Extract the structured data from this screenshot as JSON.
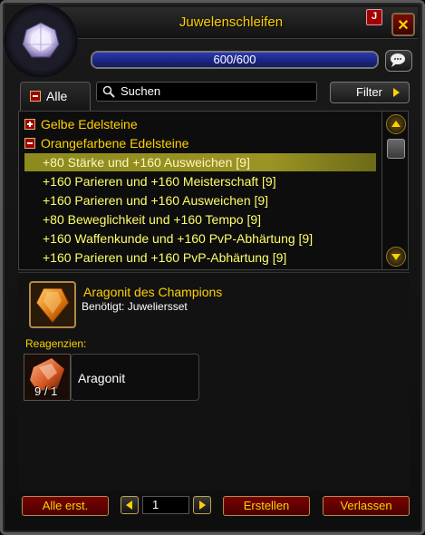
{
  "window": {
    "title": "Juwelenschleifen",
    "badge": "J"
  },
  "close_label": "✕",
  "progress": {
    "text": "600/600",
    "fraction": 1.0
  },
  "category_tab": {
    "label": "Alle"
  },
  "search": {
    "value": "Suchen"
  },
  "filter": {
    "label": "Filter"
  },
  "list": {
    "categories": [
      {
        "label": "Gelbe Edelsteine",
        "expanded": false
      },
      {
        "label": "Orangefarbene Edelsteine",
        "expanded": true
      }
    ],
    "recipes": [
      {
        "label": "+80 Stärke und +160 Ausweichen [9]",
        "selected": true
      },
      {
        "label": "+160 Parieren und +160 Meisterschaft [9]",
        "selected": false
      },
      {
        "label": "+160 Parieren und +160 Ausweichen [9]",
        "selected": false
      },
      {
        "label": "+80 Beweglichkeit und +160 Tempo [9]",
        "selected": false
      },
      {
        "label": "+160 Waffenkunde und +160 PvP-Abhärtung [9]",
        "selected": false
      },
      {
        "label": "+160 Parieren und +160 PvP-Abhärtung [9]",
        "selected": false
      }
    ]
  },
  "detail": {
    "item_name": "Aragonit des Champions",
    "requires": "Benötigt:  Juweliersset",
    "reagents_title": "Reagenzien:",
    "reagents": [
      {
        "name": "Aragonit",
        "count": "9 / 1"
      }
    ]
  },
  "buttons": {
    "create_all": "Alle erst.",
    "quantity": "1",
    "create": "Erstellen",
    "exit": "Verlassen"
  },
  "colors": {
    "gold": "#ffd100",
    "highlight": "#9a9424",
    "progress": "#1a237e"
  }
}
